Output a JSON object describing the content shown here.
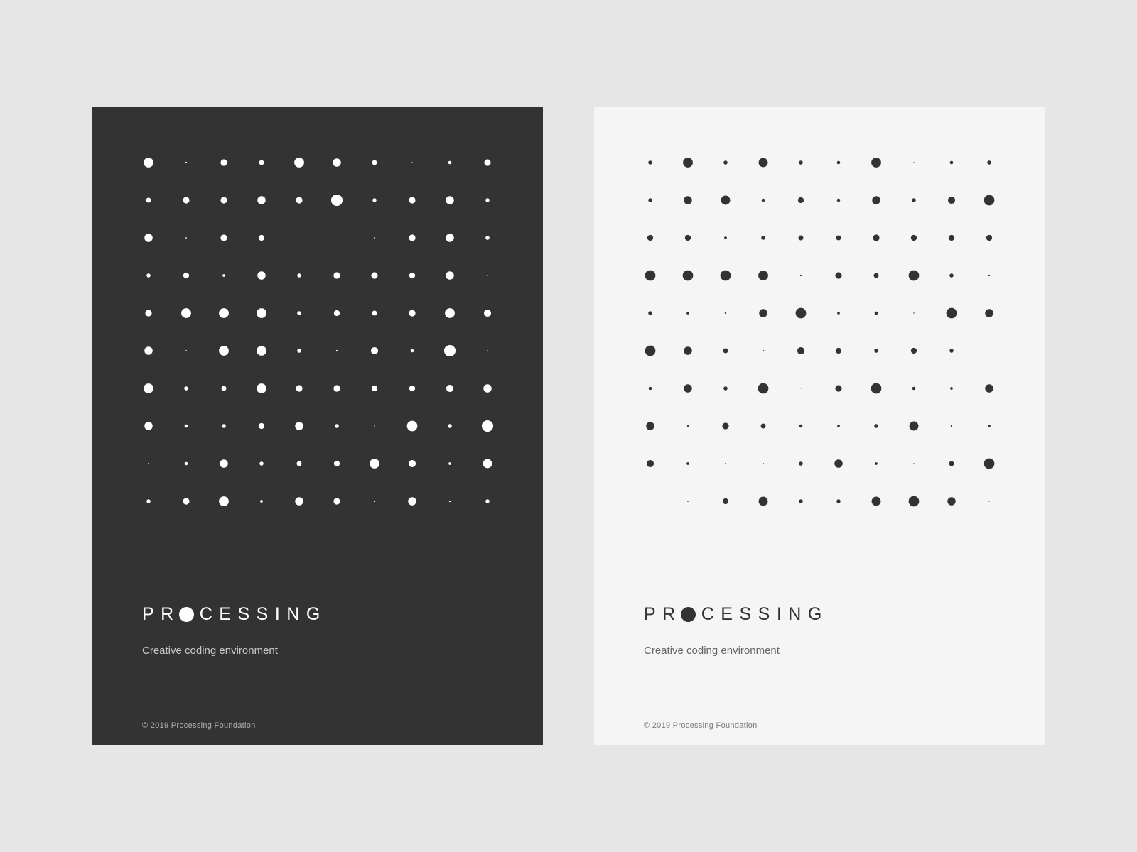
{
  "colors": {
    "background": "#e6e6e6",
    "dark_poster": "#333333",
    "light_poster": "#f5f5f5",
    "dark_dots": "#ffffff",
    "light_dots": "#333333"
  },
  "posters": [
    {
      "theme": "dark",
      "wordmark_before": "PR",
      "wordmark_after": "CESSING",
      "tagline": "Creative coding environment",
      "copyright": "© 2019 Processing Foundation",
      "dot_sizes": [
        [
          3,
          0.5,
          2,
          1.5,
          3,
          2.5,
          1.5,
          0.3,
          1,
          2
        ],
        [
          1.5,
          2,
          2,
          2.5,
          2,
          3.5,
          1.2,
          2,
          2.5,
          1.2
        ],
        [
          2.5,
          0.4,
          2,
          1.8,
          0,
          0,
          0.4,
          2,
          2.5,
          1.2
        ],
        [
          1.2,
          1.8,
          0.8,
          2.5,
          1.2,
          2,
          2,
          1.8,
          2.5,
          0.3
        ],
        [
          2,
          3,
          3,
          3,
          1.2,
          1.8,
          1.5,
          2,
          3,
          2.2
        ],
        [
          2.5,
          0.4,
          3,
          3,
          1.2,
          0.5,
          2.2,
          1,
          3.5,
          0.3
        ],
        [
          3,
          1.2,
          1.5,
          3,
          2,
          2,
          1.8,
          1.8,
          2.2,
          2.5
        ],
        [
          2.5,
          1,
          1.2,
          1.8,
          2.5,
          1.2,
          0.3,
          3.2,
          1.2,
          3.5
        ],
        [
          0.4,
          1,
          2.5,
          1.2,
          1.5,
          1.8,
          3,
          2.2,
          0.8,
          2.8
        ],
        [
          1.2,
          2,
          3,
          0.8,
          2.5,
          2,
          0.5,
          2.5,
          0.5,
          1.2
        ]
      ]
    },
    {
      "theme": "light",
      "wordmark_before": "PR",
      "wordmark_after": "CESSING",
      "tagline": "Creative coding environment",
      "copyright": "© 2019 Processing Foundation",
      "dot_sizes": [
        [
          1.2,
          3,
          1.2,
          2.8,
          1.2,
          1,
          3,
          0.3,
          1,
          1.2
        ],
        [
          1.2,
          2.5,
          2.8,
          1,
          1.8,
          1,
          2.5,
          1.2,
          2.2,
          3.2
        ],
        [
          1.8,
          1.8,
          0.8,
          1.2,
          1.5,
          1.5,
          2,
          1.8,
          1.8,
          1.8
        ],
        [
          3.2,
          3.2,
          3.2,
          3,
          0.5,
          2,
          1.5,
          3.2,
          1.2,
          0.5
        ],
        [
          1.2,
          0.8,
          0.5,
          2.5,
          3.2,
          0.8,
          1,
          0.3,
          3.2,
          2.5
        ],
        [
          3.2,
          2.5,
          1.5,
          0.5,
          2.2,
          1.8,
          1.2,
          1.8,
          1.2,
          0
        ],
        [
          1,
          2.5,
          1.2,
          3.2,
          0.2,
          2,
          3.2,
          1,
          0.8,
          2.5
        ],
        [
          2.5,
          0.5,
          2,
          1.5,
          1,
          0.8,
          1.2,
          2.8,
          0.5,
          0.8
        ],
        [
          2.2,
          0.8,
          0.4,
          0.4,
          1.2,
          2.5,
          0.8,
          0.3,
          1.5,
          3.2
        ],
        [
          0,
          0.4,
          1.8,
          2.8,
          1.2,
          1.2,
          2.8,
          3.2,
          2.5,
          0.3
        ]
      ]
    }
  ]
}
